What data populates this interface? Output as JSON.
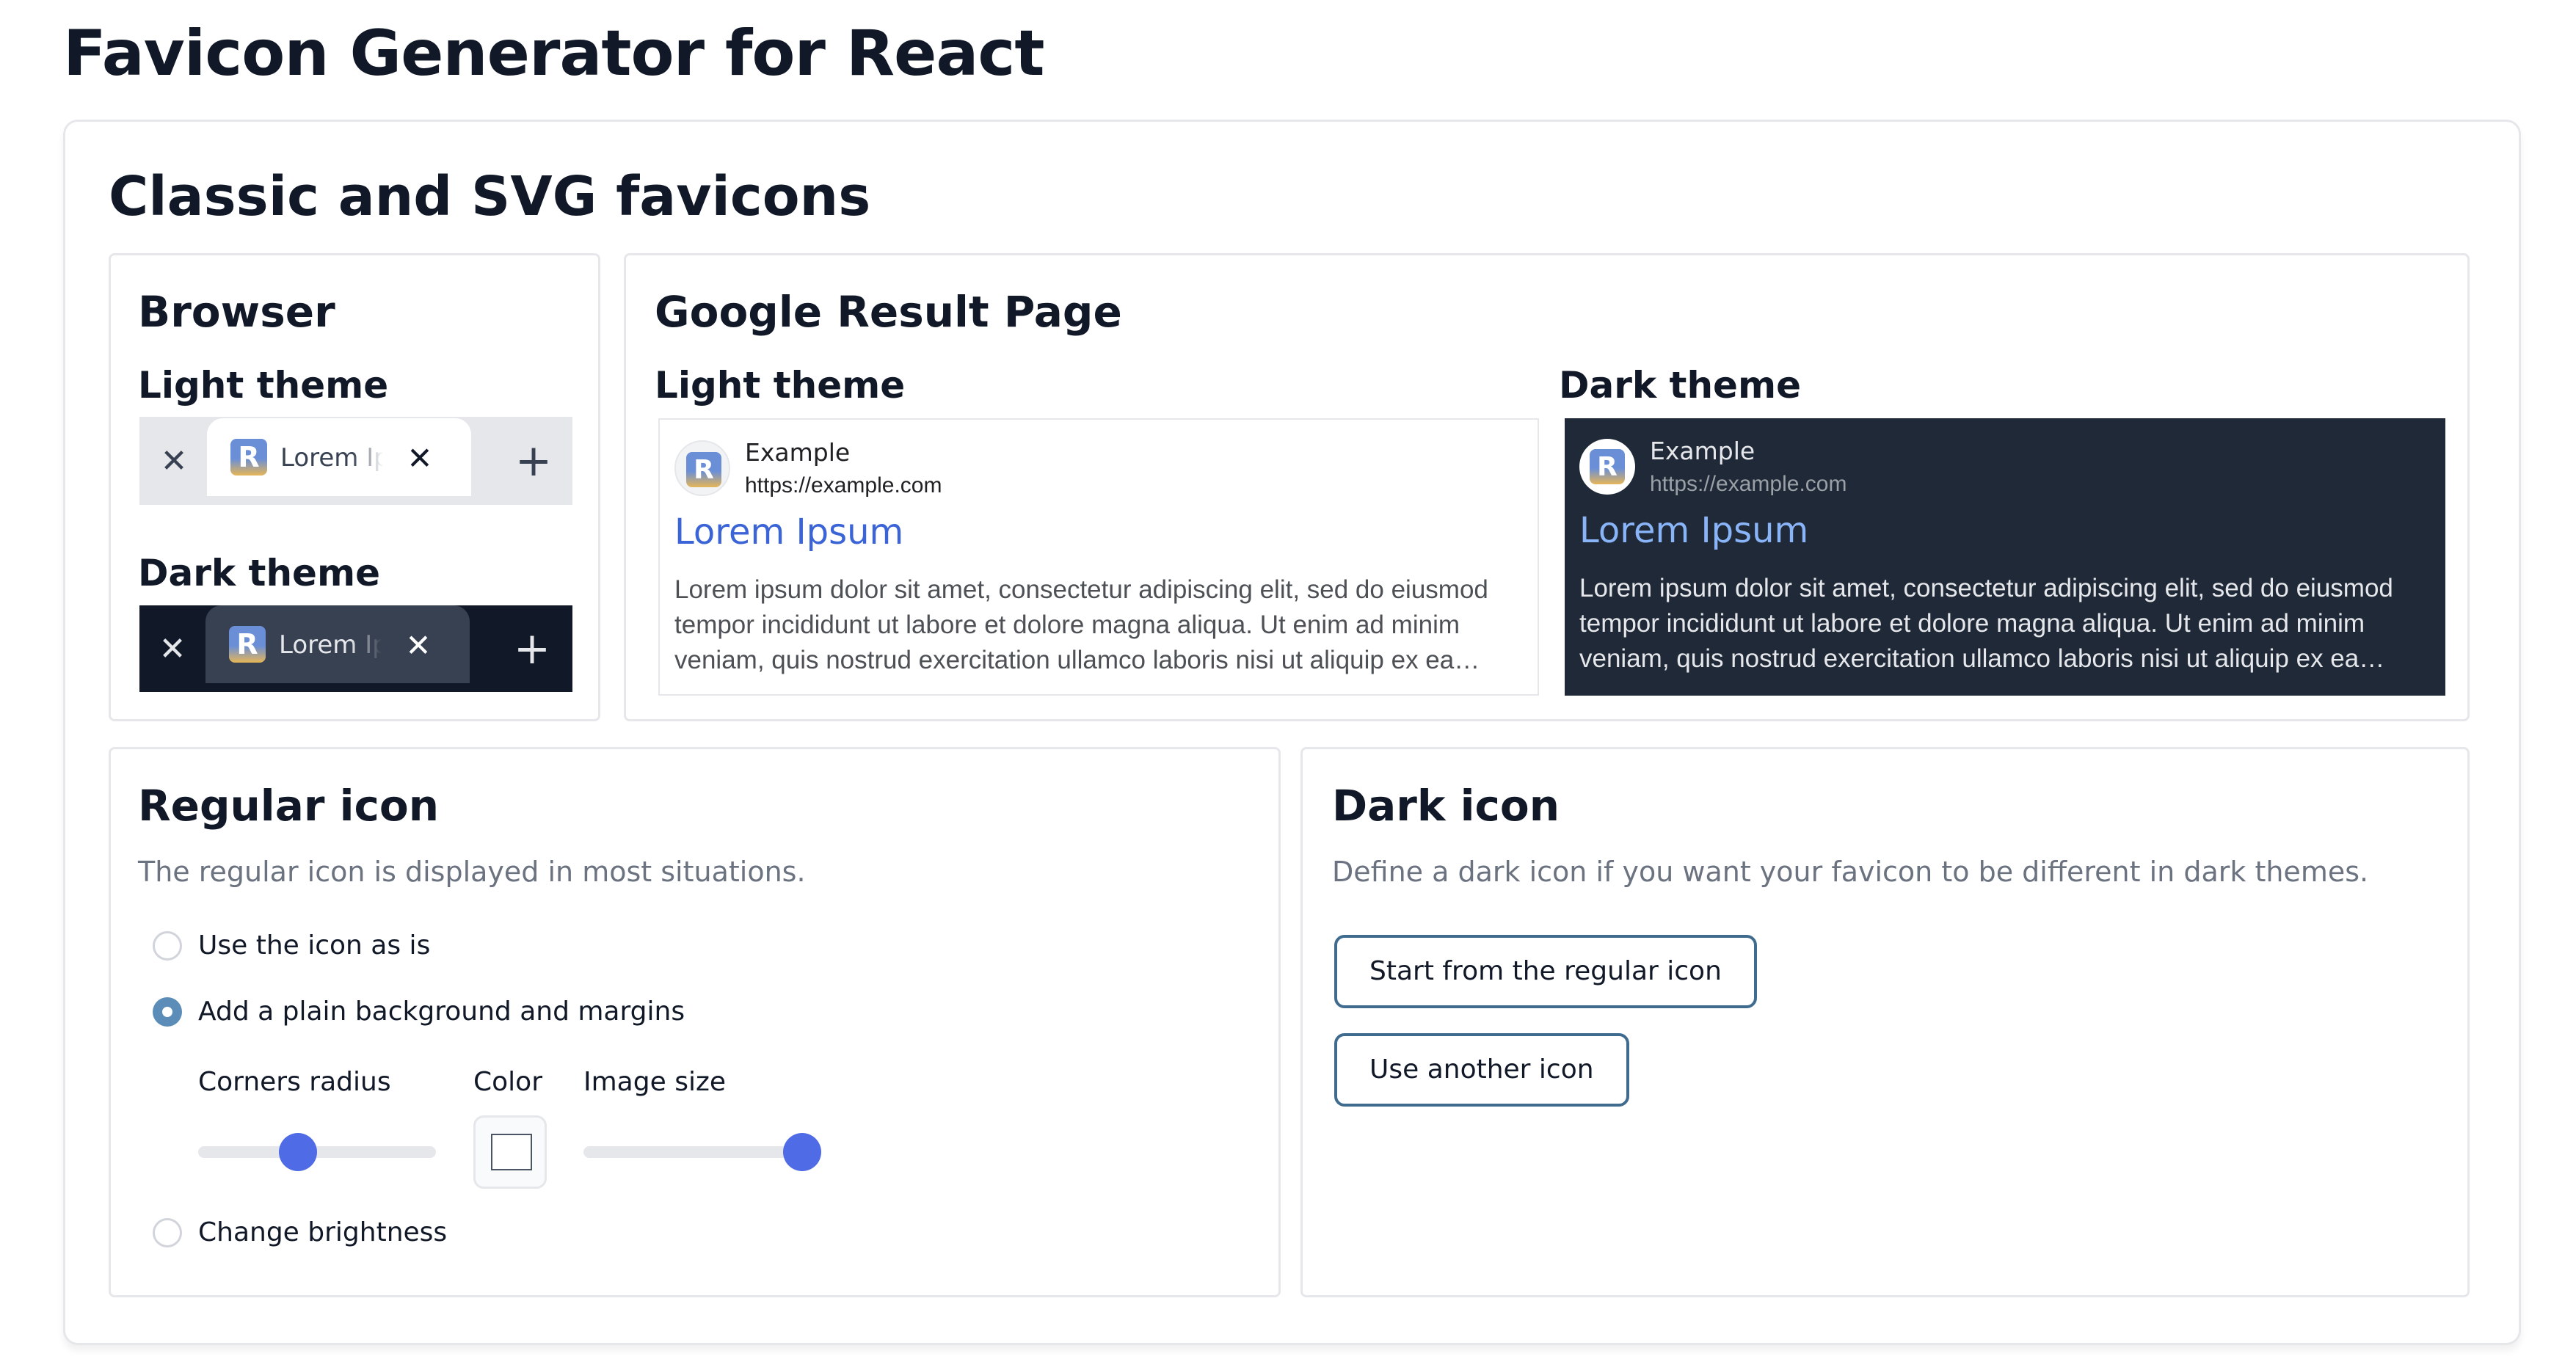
{
  "page_title": "Favicon Generator for React",
  "section": {
    "title": "Classic and SVG favicons"
  },
  "browser": {
    "title": "Browser",
    "light_label": "Light theme",
    "dark_label": "Dark theme",
    "tab_label": "Lorem Ipsum",
    "favicon_letter": "R",
    "close_glyph": "✕",
    "new_tab_glyph": "+"
  },
  "google": {
    "title": "Google Result Page",
    "light_label": "Light theme",
    "dark_label": "Dark theme",
    "site_name": "Example",
    "url": "https://example.com",
    "link_title": "Lorem Ipsum",
    "snippet": "Lorem ipsum dolor sit amet, consectetur adipiscing elit, sed do eiusmod tempor incididunt ut labore et dolore magna aliqua. Ut enim ad minim veniam, quis nostrud exercitation ullamco laboris nisi ut aliquip ex ea commodo consequat.",
    "favicon_letter": "R"
  },
  "regular_icon": {
    "title": "Regular icon",
    "description": "The regular icon is displayed in most situations.",
    "options": [
      {
        "label": "Use the icon as is",
        "checked": false
      },
      {
        "label": "Add a plain background and margins",
        "checked": true
      },
      {
        "label": "Change brightness",
        "checked": false
      }
    ],
    "corners_radius_label": "Corners radius",
    "corners_radius_value": 0.42,
    "color_label": "Color",
    "color_value": "#ffffff",
    "image_size_label": "Image size",
    "image_size_value": 0.92
  },
  "dark_icon": {
    "title": "Dark icon",
    "description": "Define a dark icon if you want your favicon to be different in dark themes.",
    "start_regular_button": "Start from the regular icon",
    "use_another_button": "Use another icon"
  },
  "colors": {
    "accent": "#4f6be6",
    "radio_checked": "#5b8db8",
    "button_border": "#3f6b8f",
    "dark_serp_bg": "#1f2937",
    "dark_tab_bg": "#111827"
  },
  "icons": {
    "close": "close-icon",
    "plus": "plus-icon",
    "favicon": "react-favicon-icon"
  }
}
